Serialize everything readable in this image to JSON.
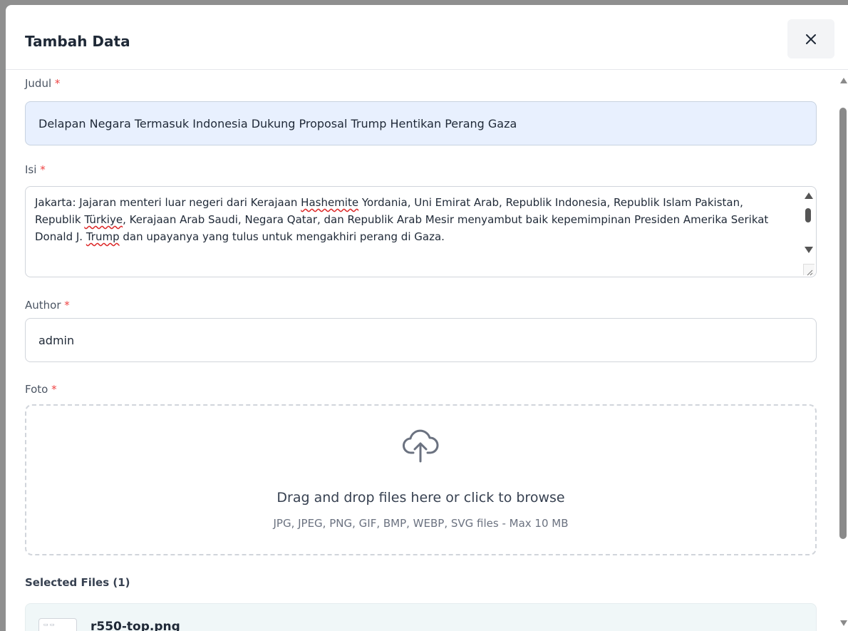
{
  "modal": {
    "title": "Tambah Data",
    "close_icon": "close-icon"
  },
  "form": {
    "judul": {
      "label": "Judul",
      "required_mark": "*",
      "value": "Delapan Negara Termasuk Indonesia Dukung Proposal Trump Hentikan Perang Gaza"
    },
    "isi": {
      "label": "Isi",
      "required_mark": "*",
      "segments": [
        "Jakarta: Jajaran menteri luar negeri dari Kerajaan ",
        "Hashemite",
        " Yordania, Uni Emirat Arab, Republik Indonesia, Republik Islam Pakistan, Republik ",
        "Türkiye",
        ", Kerajaan Arab Saudi, Negara Qatar, dan Republik Arab Mesir menyambut baik kepemimpinan Presiden Amerika Serikat Donald J. ",
        "Trump",
        " dan upayanya yang tulus untuk mengakhiri perang di Gaza."
      ]
    },
    "author": {
      "label": "Author",
      "required_mark": "*",
      "value": "admin"
    },
    "foto": {
      "label": "Foto",
      "required_mark": "*",
      "dropzone_icon": "cloud-upload-icon",
      "dropzone_title": "Drag and drop files here or click to browse",
      "dropzone_subtitle": "JPG, JPEG, PNG, GIF, BMP, WEBP, SVG files - Max 10 MB"
    },
    "selected_files": {
      "title": "Selected Files (1)",
      "files": [
        {
          "name": "r550-top.png"
        }
      ]
    }
  },
  "colors": {
    "required": "#ef4444",
    "autofill_background": "#e8f0fe",
    "file_card_background": "#f0f7f8"
  }
}
